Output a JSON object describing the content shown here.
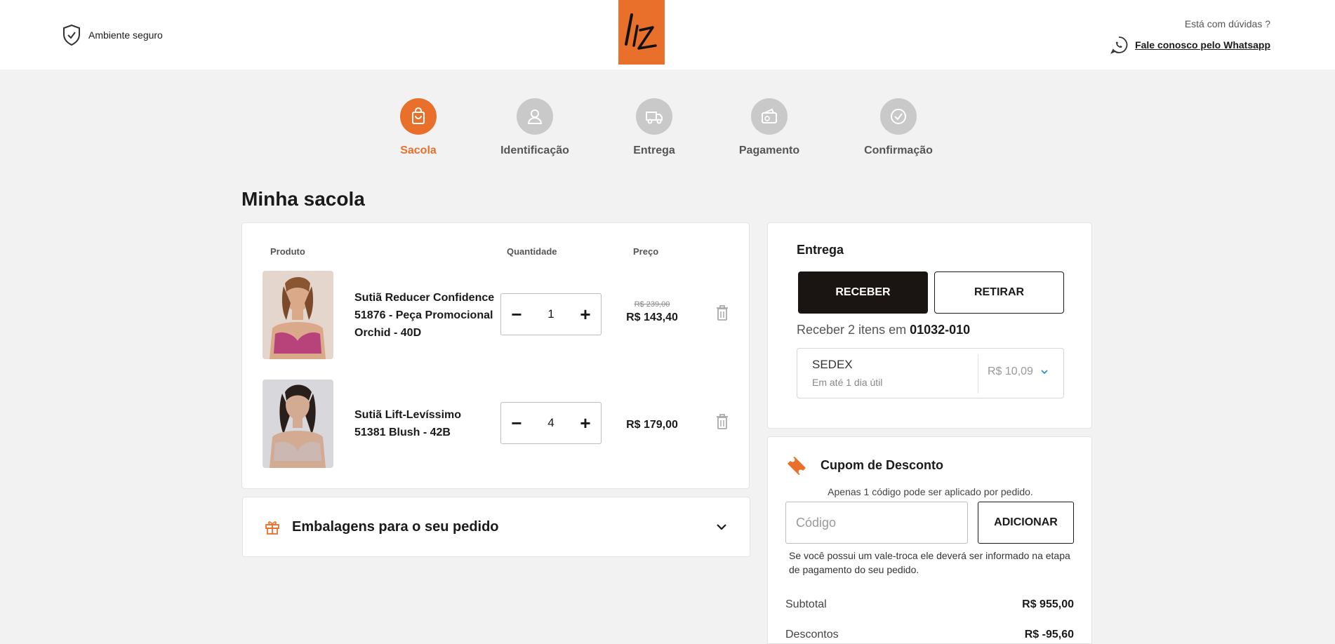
{
  "header": {
    "secure_label": "Ambiente seguro",
    "logo_text": "liz",
    "help_question": "Está com dúvidas ?",
    "help_link": "Fale conosco pelo Whatsapp"
  },
  "steps": [
    {
      "label": "Sacola",
      "icon": "bag-icon",
      "active": true
    },
    {
      "label": "Identificação",
      "icon": "user-icon",
      "active": false
    },
    {
      "label": "Entrega",
      "icon": "truck-icon",
      "active": false
    },
    {
      "label": "Pagamento",
      "icon": "wallet-icon",
      "active": false
    },
    {
      "label": "Confirmação",
      "icon": "check-circle-icon",
      "active": false
    }
  ],
  "page_title": "Minha sacola",
  "cart": {
    "columns": {
      "product": "Produto",
      "quantity": "Quantidade",
      "price": "Preço"
    },
    "items": [
      {
        "name_lines": [
          "Sutiã Reducer Confidence",
          "51876 - Peça Promocional",
          "Orchid - 40D"
        ],
        "quantity": "1",
        "old_price": "R$ 239,00",
        "price": "R$ 143,40"
      },
      {
        "name_lines": [
          "Sutiã Lift-Levíssimo",
          "51381 Blush - 42B"
        ],
        "quantity": "4",
        "old_price": "",
        "price": "R$ 179,00"
      }
    ]
  },
  "packaging": {
    "label": "Embalagens para o seu pedido"
  },
  "delivery": {
    "title": "Entrega",
    "receive_button": "RECEBER",
    "pickup_button": "RETIRAR",
    "receive_text": "Receber 2 itens em",
    "cep": "01032-010",
    "shipping": {
      "name": "SEDEX",
      "eta": "Em até 1 dia útil",
      "price": "R$ 10,09"
    }
  },
  "coupon": {
    "title": "Cupom de Desconto",
    "note": "Apenas 1 código pode ser aplicado por pedido.",
    "placeholder": "Código",
    "button": "ADICIONAR",
    "voucher_note": "Se você possui um vale-troca ele deverá ser informado na etapa de pagamento do seu pedido."
  },
  "summary": {
    "subtotal_label": "Subtotal",
    "subtotal_value": "R$ 955,00",
    "discount_label": "Descontos",
    "discount_value": "R$ -95,60"
  },
  "colors": {
    "accent": "#e8702a",
    "dark": "#1a1412",
    "bg": "#f2f2f2"
  }
}
